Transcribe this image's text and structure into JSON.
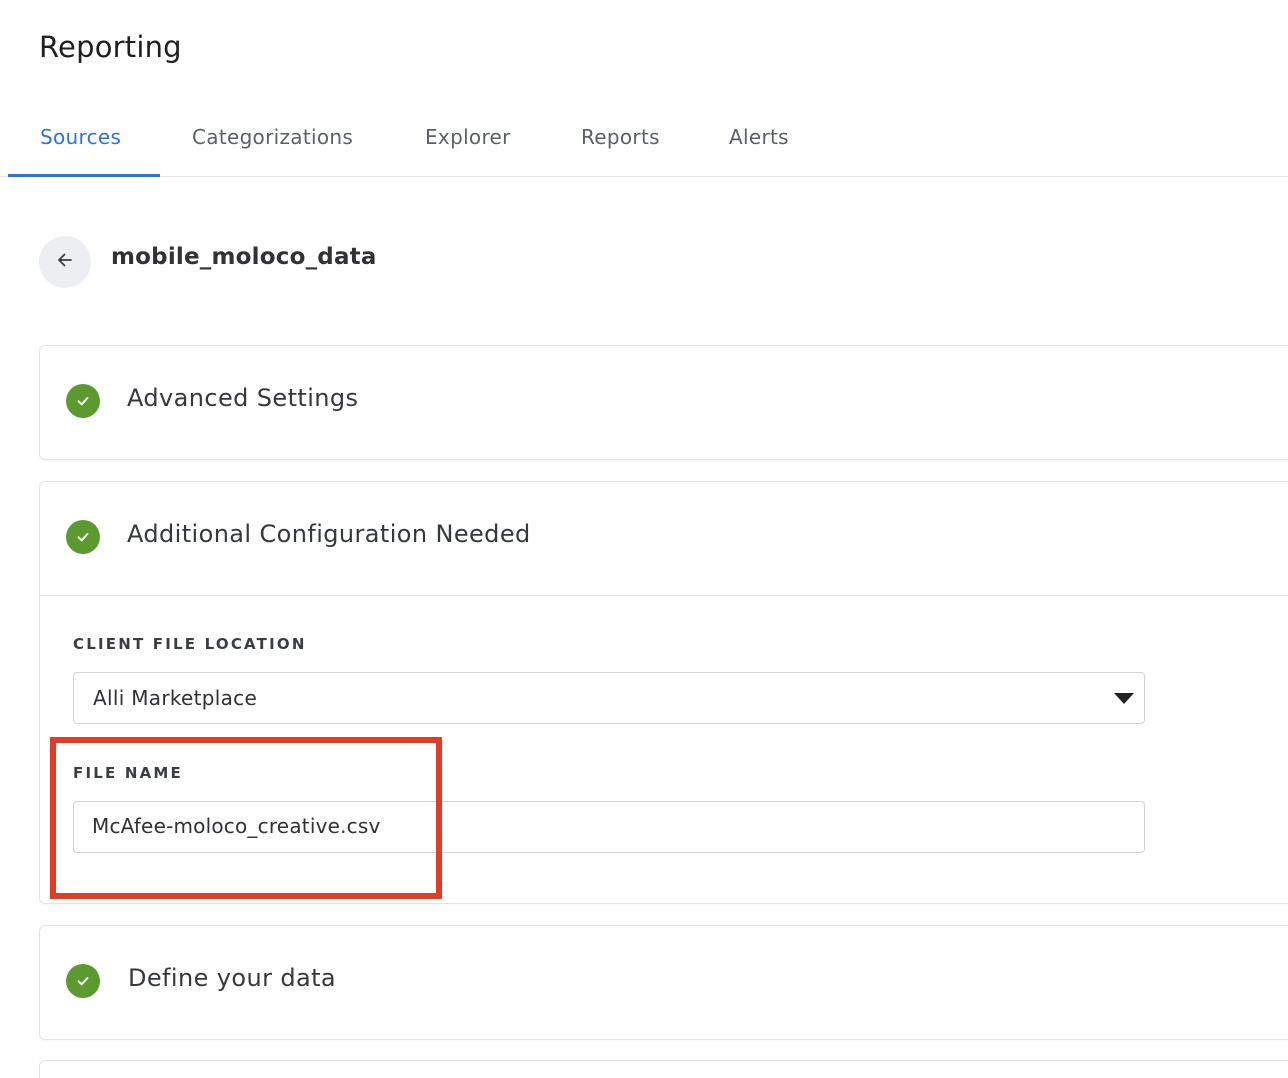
{
  "header": {
    "title": "Reporting"
  },
  "tabs": [
    {
      "label": "Sources",
      "active": true
    },
    {
      "label": "Categorizations",
      "active": false
    },
    {
      "label": "Explorer",
      "active": false
    },
    {
      "label": "Reports",
      "active": false
    },
    {
      "label": "Alerts",
      "active": false
    }
  ],
  "source": {
    "name": "mobile_moloco_data"
  },
  "sections": {
    "advanced": {
      "title": "Advanced Settings",
      "status": "complete"
    },
    "additional": {
      "title": "Additional Configuration Needed",
      "status": "complete",
      "client_file_location": {
        "label": "CLIENT FILE LOCATION",
        "value": "Alli Marketplace"
      },
      "file_name": {
        "label": "FILE NAME",
        "value": "McAfee-moloco_creative.csv"
      }
    },
    "define": {
      "title": "Define your data",
      "status": "complete"
    }
  },
  "colors": {
    "accent": "#2f73d9",
    "success": "#5a9a2f",
    "highlight": "#e23c26"
  }
}
